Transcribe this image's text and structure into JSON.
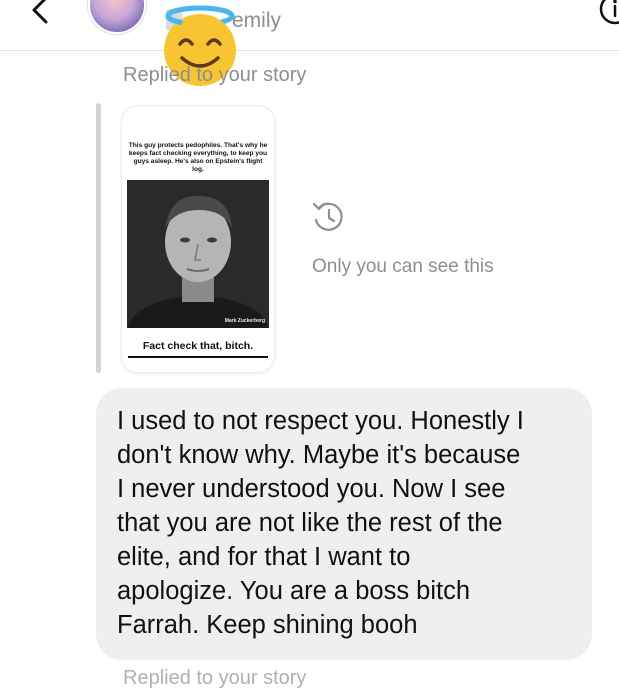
{
  "header": {
    "username": "emily",
    "icons": {
      "back": "chevron-left-icon",
      "info": "info-icon"
    }
  },
  "sticker": {
    "name": "smiling-face-with-halo-icon"
  },
  "reply": {
    "label": "Replied to your story",
    "visible_label": "Replie your story"
  },
  "story": {
    "caption": "This guy protects pedophiles. That's why he keeps fact checking everything, to keep you guys asleep. He's also on Epstein's flight log.",
    "photo_label": "Mark Zuckerberg",
    "bottom_text": "Fact check that, bitch."
  },
  "visibility": {
    "icon": "history-icon",
    "text": "Only you can see this"
  },
  "message": {
    "text": "I used to not respect you. Honestly I\ndon't know why. Maybe it's because\nI never understood you. Now I see\nthat you are not like the rest of the\nelite, and for that I want to\napologize. You are a boss bitch\nFarrah. Keep shining booh"
  },
  "next_reply": {
    "label": "Replied to your story"
  },
  "colors": {
    "muted_text": "#8e8e8e",
    "bubble_bg": "#efefef",
    "divider": "#e3e3e3",
    "emoji_yellow": "#f7c531"
  }
}
